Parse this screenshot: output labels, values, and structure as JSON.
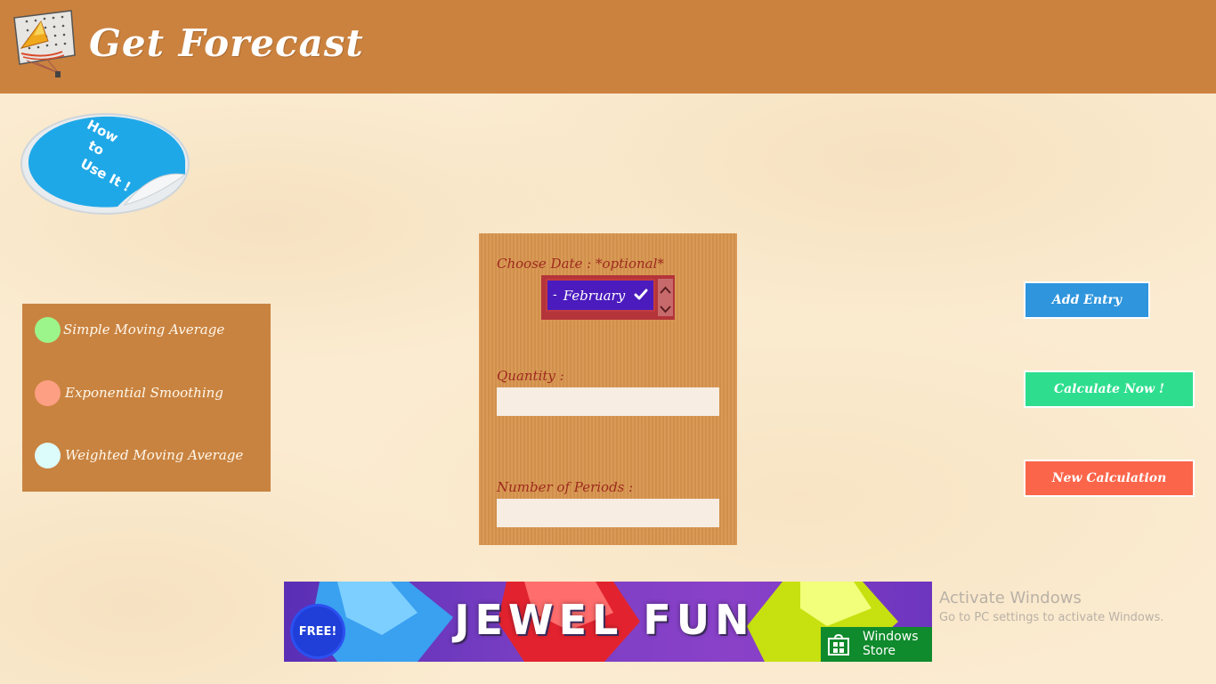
{
  "header": {
    "title": "Get Forecast",
    "logo_icon": "forecast-chart-logo-icon",
    "background": "#cb823f"
  },
  "how_to": {
    "line1": "How",
    "line2": "to",
    "line3": "Use It !",
    "icon": "peeling-sticker-icon"
  },
  "legend": {
    "items": [
      {
        "label": "Simple Moving Average",
        "color": "#9cf58a"
      },
      {
        "label": "Exponential Smoothing",
        "color": "#fc9f82"
      },
      {
        "label": "Weighted Moving Average",
        "color": "#dcfbfb"
      }
    ]
  },
  "form": {
    "date_label": "Choose Date : *optional*",
    "date_prefix": "-",
    "date_value": "February",
    "quantity_label": "Quantity :",
    "quantity_value": "",
    "periods_label": "Number of Periods :",
    "periods_value": ""
  },
  "actions": {
    "add_entry": {
      "label": "Add Entry",
      "color": "#2f95dd"
    },
    "calculate": {
      "label": "Calculate Now !",
      "color": "#2ede8e"
    },
    "new_calc": {
      "label": "New Calculation",
      "color": "#fb654a"
    }
  },
  "ad": {
    "badge": "FREE!",
    "title": "JEWEL FUN",
    "store_line1": "Windows",
    "store_line2": "Store"
  },
  "watermark": {
    "title": "Activate Windows",
    "subtitle": "Go to PC settings to activate Windows."
  }
}
